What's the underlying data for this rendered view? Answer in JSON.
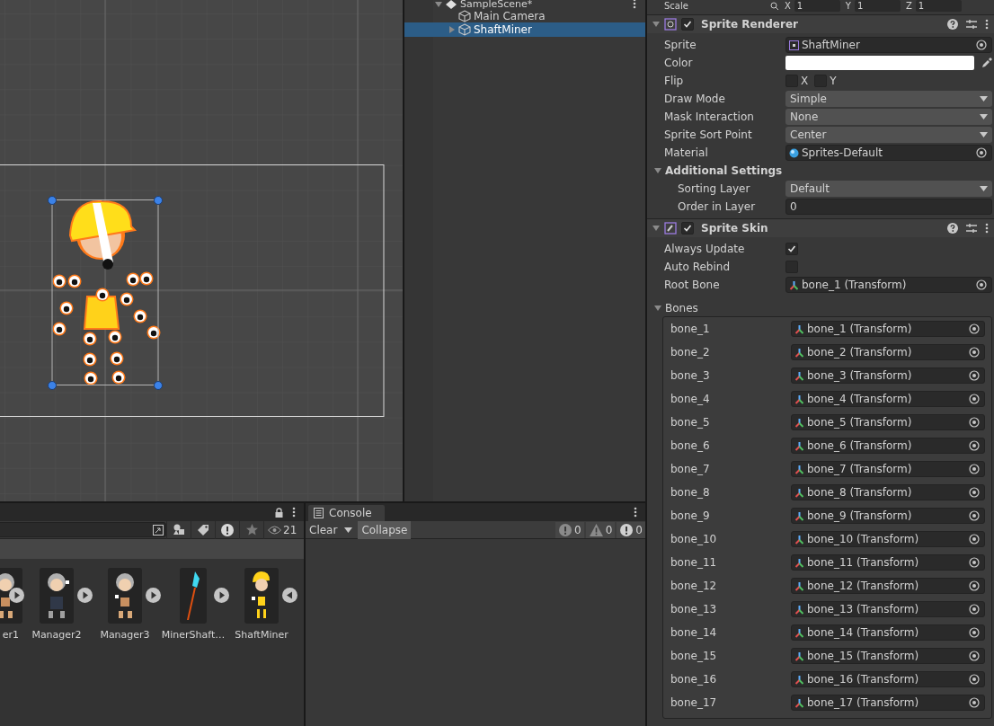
{
  "hierarchy": {
    "scene": "SampleScene*",
    "items": [
      {
        "label": "Main Camera",
        "kind": "object",
        "selected": false
      },
      {
        "label": "ShaftMiner",
        "kind": "group",
        "selected": true
      }
    ]
  },
  "inspector": {
    "transform": {
      "label": "Scale",
      "axes": [
        {
          "axis": "X",
          "value": "1"
        },
        {
          "axis": "Y",
          "value": "1"
        },
        {
          "axis": "Z",
          "value": "1"
        }
      ]
    },
    "components": [
      {
        "title": "Sprite Renderer",
        "kind": "renderer",
        "enabled": true,
        "fields": [
          {
            "kind": "sprite-ref",
            "label": "Sprite",
            "value": "ShaftMiner"
          },
          {
            "kind": "color",
            "label": "Color",
            "color": "#ffffff"
          },
          {
            "kind": "flip",
            "label": "Flip",
            "options": [
              {
                "label": "X",
                "checked": false
              },
              {
                "label": "Y",
                "checked": false
              }
            ]
          },
          {
            "kind": "dropdown",
            "label": "Draw Mode",
            "value": "Simple"
          },
          {
            "kind": "dropdown",
            "label": "Mask Interaction",
            "value": "None"
          },
          {
            "kind": "dropdown",
            "label": "Sprite Sort Point",
            "value": "Center"
          },
          {
            "kind": "material-ref",
            "label": "Material",
            "value": "Sprites-Default"
          },
          {
            "kind": "section",
            "label": "Additional Settings",
            "expanded": true,
            "children": [
              {
                "kind": "dropdown",
                "label": "Sorting Layer",
                "value": "Default"
              },
              {
                "kind": "number",
                "label": "Order in Layer",
                "value": "0"
              }
            ]
          }
        ]
      },
      {
        "title": "Sprite Skin",
        "kind": "skin",
        "enabled": true,
        "fields": [
          {
            "kind": "checkbox",
            "label": "Always Update",
            "checked": true
          },
          {
            "kind": "checkbox",
            "label": "Auto Rebind",
            "checked": false
          },
          {
            "kind": "bone-ref",
            "label": "Root Bone",
            "value": "bone_1 (Transform)"
          },
          {
            "kind": "list",
            "label": "Bones",
            "expanded": true,
            "rows": [
              {
                "label": "bone_1",
                "value": "bone_1 (Transform)"
              },
              {
                "label": "bone_2",
                "value": "bone_2 (Transform)"
              },
              {
                "label": "bone_3",
                "value": "bone_3 (Transform)"
              },
              {
                "label": "bone_4",
                "value": "bone_4 (Transform)"
              },
              {
                "label": "bone_5",
                "value": "bone_5 (Transform)"
              },
              {
                "label": "bone_6",
                "value": "bone_6 (Transform)"
              },
              {
                "label": "bone_7",
                "value": "bone_7 (Transform)"
              },
              {
                "label": "bone_8",
                "value": "bone_8 (Transform)"
              },
              {
                "label": "bone_9",
                "value": "bone_9 (Transform)"
              },
              {
                "label": "bone_10",
                "value": "bone_10 (Transform)"
              },
              {
                "label": "bone_11",
                "value": "bone_11 (Transform)"
              },
              {
                "label": "bone_12",
                "value": "bone_12 (Transform)"
              },
              {
                "label": "bone_13",
                "value": "bone_13 (Transform)"
              },
              {
                "label": "bone_14",
                "value": "bone_14 (Transform)"
              },
              {
                "label": "bone_15",
                "value": "bone_15 (Transform)"
              },
              {
                "label": "bone_16",
                "value": "bone_16 (Transform)"
              },
              {
                "label": "bone_17",
                "value": "bone_17 (Transform)"
              }
            ]
          }
        ]
      }
    ]
  },
  "project": {
    "visible_count": "21",
    "assets": [
      {
        "label": "er1",
        "kind": "picture",
        "expanded": false
      },
      {
        "label": "Manager2",
        "kind": "picture",
        "expanded": false
      },
      {
        "label": "Manager3",
        "kind": "picture",
        "expanded": false
      },
      {
        "label": "MinerShaft…",
        "kind": "picture",
        "expanded": false
      },
      {
        "label": "ShaftMiner",
        "kind": "picture",
        "expanded": true
      }
    ]
  },
  "console": {
    "tab": "Console",
    "buttons": [
      {
        "label": "Clear",
        "selected": false
      },
      {
        "label": "Collapse",
        "selected": true
      }
    ],
    "counts": [
      {
        "kind": "info",
        "value": "0"
      },
      {
        "kind": "warning",
        "value": "0"
      },
      {
        "kind": "error",
        "value": "0"
      }
    ]
  }
}
